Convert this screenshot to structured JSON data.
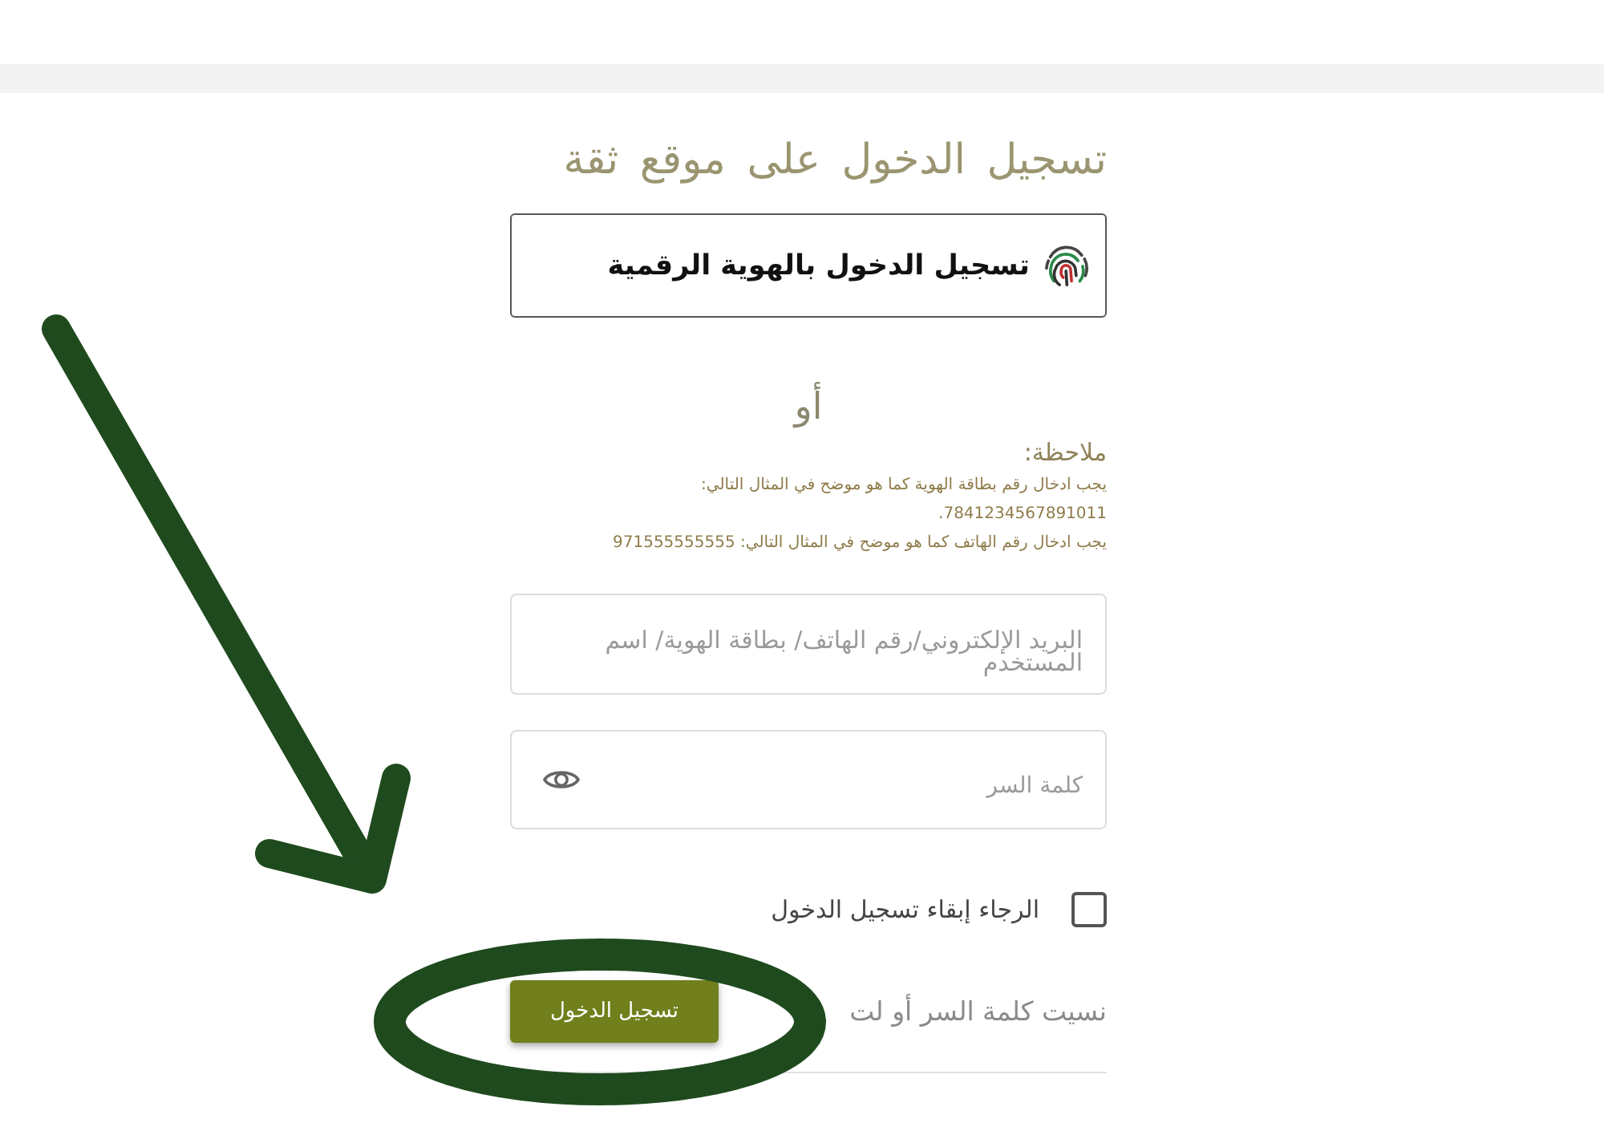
{
  "title": "تسجيل الدخول على موقع ثقة",
  "digital_id_button": {
    "label": "تسجيل الدخول بالهوية الرقمية"
  },
  "separator_text": "أو",
  "note": {
    "heading": "ملاحظة:",
    "lines": [
      "يجب ادخال رقم بطاقة الهوية كما هو موضح في المثال التالي:",
      "7841234567891011.",
      "يجب ادخال رقم الهاتف كما هو موضح في المثال التالي: 971555555555"
    ]
  },
  "username_field": {
    "placeholder": "البريد الإلكتروني/رقم الهاتف/ بطاقة الهوية/ اسم المستخدم"
  },
  "password_field": {
    "placeholder": "كلمة السر"
  },
  "remember_me": {
    "label": "الرجاء إبقاء تسجيل الدخول",
    "checked": false
  },
  "login_button": {
    "label": "تسجيل الدخول"
  },
  "forgot_link": {
    "label": "نسيت كلمة السر أو لت"
  }
}
